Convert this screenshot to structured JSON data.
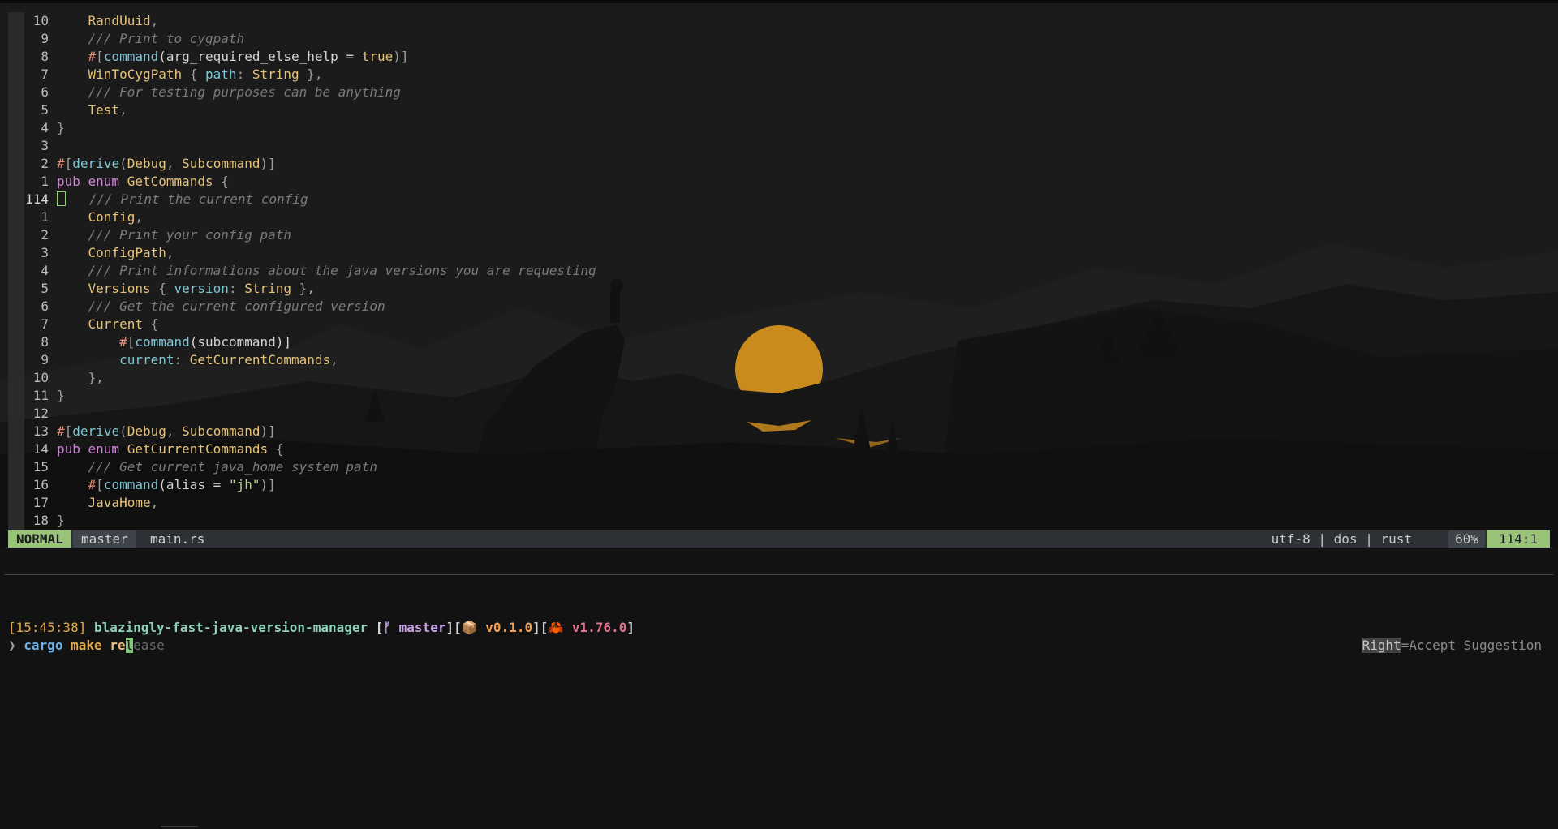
{
  "editor": {
    "lines": [
      {
        "num": "10",
        "ind": "    ",
        "parts": [
          {
            "t": "RandUuid",
            "c": "ty"
          },
          {
            "t": ",",
            "c": "pu"
          }
        ]
      },
      {
        "num": "9",
        "ind": "    ",
        "parts": [
          {
            "t": "/// Print to cygpath",
            "c": "cm"
          }
        ]
      },
      {
        "num": "8",
        "ind": "    ",
        "parts": [
          {
            "t": "#",
            "c": "hash"
          },
          {
            "t": "[",
            "c": "pu"
          },
          {
            "t": "command",
            "c": "fn"
          },
          {
            "t": "(arg_required_else_help = ",
            "c": ""
          },
          {
            "t": "true",
            "c": "bo"
          },
          {
            "t": ")]",
            "c": "pu"
          }
        ]
      },
      {
        "num": "7",
        "ind": "    ",
        "parts": [
          {
            "t": "WinToCygPath",
            "c": "ty"
          },
          {
            "t": " { ",
            "c": "pu"
          },
          {
            "t": "path",
            "c": "fd"
          },
          {
            "t": ": ",
            "c": "pu"
          },
          {
            "t": "String",
            "c": "ty"
          },
          {
            "t": " },",
            "c": "pu"
          }
        ]
      },
      {
        "num": "6",
        "ind": "    ",
        "parts": [
          {
            "t": "/// For testing purposes can be anything",
            "c": "cm"
          }
        ]
      },
      {
        "num": "5",
        "ind": "    ",
        "parts": [
          {
            "t": "Test",
            "c": "ty"
          },
          {
            "t": ",",
            "c": "pu"
          }
        ]
      },
      {
        "num": "4",
        "ind": "",
        "parts": [
          {
            "t": "}",
            "c": "pu"
          }
        ]
      },
      {
        "num": "3",
        "ind": "",
        "parts": []
      },
      {
        "num": "2",
        "ind": "",
        "parts": [
          {
            "t": "#",
            "c": "hash"
          },
          {
            "t": "[",
            "c": "pu"
          },
          {
            "t": "derive",
            "c": "fn"
          },
          {
            "t": "(",
            "c": "pu"
          },
          {
            "t": "Debug",
            "c": "ty"
          },
          {
            "t": ", ",
            "c": "pu"
          },
          {
            "t": "Subcommand",
            "c": "ty"
          },
          {
            "t": ")]",
            "c": "pu"
          }
        ]
      },
      {
        "num": "1",
        "ind": "",
        "parts": [
          {
            "t": "pub enum ",
            "c": "kw"
          },
          {
            "t": "GetCommands",
            "c": "ty"
          },
          {
            "t": " {",
            "c": "pu"
          }
        ]
      },
      {
        "num": "114",
        "ind": "",
        "cur": true,
        "parts": [
          {
            "t": "/// Print the current config",
            "c": "cm"
          }
        ]
      },
      {
        "num": "1",
        "ind": "    ",
        "parts": [
          {
            "t": "Config",
            "c": "ty"
          },
          {
            "t": ",",
            "c": "pu"
          }
        ]
      },
      {
        "num": "2",
        "ind": "    ",
        "parts": [
          {
            "t": "/// Print your config path",
            "c": "cm"
          }
        ]
      },
      {
        "num": "3",
        "ind": "    ",
        "parts": [
          {
            "t": "ConfigPath",
            "c": "ty"
          },
          {
            "t": ",",
            "c": "pu"
          }
        ]
      },
      {
        "num": "4",
        "ind": "    ",
        "parts": [
          {
            "t": "/// Print informations about the java versions you are requesting",
            "c": "cm"
          }
        ]
      },
      {
        "num": "5",
        "ind": "    ",
        "parts": [
          {
            "t": "Versions",
            "c": "ty"
          },
          {
            "t": " { ",
            "c": "pu"
          },
          {
            "t": "version",
            "c": "fd"
          },
          {
            "t": ": ",
            "c": "pu"
          },
          {
            "t": "String",
            "c": "ty"
          },
          {
            "t": " },",
            "c": "pu"
          }
        ]
      },
      {
        "num": "6",
        "ind": "    ",
        "parts": [
          {
            "t": "/// Get the current configured version",
            "c": "cm"
          }
        ]
      },
      {
        "num": "7",
        "ind": "    ",
        "parts": [
          {
            "t": "Current",
            "c": "ty"
          },
          {
            "t": " {",
            "c": "pu"
          }
        ]
      },
      {
        "num": "8",
        "ind": "        ",
        "parts": [
          {
            "t": "#",
            "c": "hash"
          },
          {
            "t": "[",
            "c": "pu"
          },
          {
            "t": "command",
            "c": "fn"
          },
          {
            "t": "(subcommand)]",
            "c": ""
          }
        ]
      },
      {
        "num": "9",
        "ind": "        ",
        "parts": [
          {
            "t": "current",
            "c": "fd"
          },
          {
            "t": ": ",
            "c": "pu"
          },
          {
            "t": "GetCurrentCommands",
            "c": "ty"
          },
          {
            "t": ",",
            "c": "pu"
          }
        ]
      },
      {
        "num": "10",
        "ind": "    ",
        "parts": [
          {
            "t": "},",
            "c": "pu"
          }
        ]
      },
      {
        "num": "11",
        "ind": "",
        "parts": [
          {
            "t": "}",
            "c": "pu"
          }
        ]
      },
      {
        "num": "12",
        "ind": "",
        "parts": []
      },
      {
        "num": "13",
        "ind": "",
        "parts": [
          {
            "t": "#",
            "c": "hash"
          },
          {
            "t": "[",
            "c": "pu"
          },
          {
            "t": "derive",
            "c": "fn"
          },
          {
            "t": "(",
            "c": "pu"
          },
          {
            "t": "Debug",
            "c": "ty"
          },
          {
            "t": ", ",
            "c": "pu"
          },
          {
            "t": "Subcommand",
            "c": "ty"
          },
          {
            "t": ")]",
            "c": "pu"
          }
        ]
      },
      {
        "num": "14",
        "ind": "",
        "parts": [
          {
            "t": "pub enum ",
            "c": "kw"
          },
          {
            "t": "GetCurrentCommands",
            "c": "ty"
          },
          {
            "t": " {",
            "c": "pu"
          }
        ]
      },
      {
        "num": "15",
        "ind": "    ",
        "parts": [
          {
            "t": "/// Get current java_home system path",
            "c": "cm"
          }
        ]
      },
      {
        "num": "16",
        "ind": "    ",
        "parts": [
          {
            "t": "#",
            "c": "hash"
          },
          {
            "t": "[",
            "c": "pu"
          },
          {
            "t": "command",
            "c": "fn"
          },
          {
            "t": "(alias = ",
            "c": ""
          },
          {
            "t": "\"jh\"",
            "c": "st"
          },
          {
            "t": ")]",
            "c": "pu"
          }
        ]
      },
      {
        "num": "17",
        "ind": "    ",
        "parts": [
          {
            "t": "JavaHome",
            "c": "ty"
          },
          {
            "t": ",",
            "c": "pu"
          }
        ]
      },
      {
        "num": "18",
        "ind": "",
        "parts": [
          {
            "t": "}",
            "c": "pu"
          }
        ]
      }
    ]
  },
  "statusbar": {
    "mode": "NORMAL",
    "branch": "master",
    "file": "main.rs",
    "info": "utf-8 | dos | rust",
    "percent": "60%",
    "position": "114:1"
  },
  "terminal": {
    "time": "[15:45:38]",
    "directory": "blazingly-fast-java-version-manager",
    "branch_icon": "ᚠ",
    "branch": "master",
    "package_icon": "📦",
    "package_version": "v0.1.0",
    "rust_icon": "🦀",
    "rust_version": "v1.76.0",
    "prompt_symbol": "❯",
    "cmd_cargo": "cargo",
    "cmd_make": "make",
    "cmd_typed": "re",
    "cmd_cursor_char": "l",
    "cmd_suggestion": "ease",
    "hint_key": "Right",
    "hint_text": "=Accept Suggestion"
  },
  "colors": {
    "mode_bg": "#98c379",
    "comment": "#7a7a7a",
    "type": "#e5c27c",
    "keyword": "#d085d8",
    "attr_fn": "#7fc7d6"
  }
}
